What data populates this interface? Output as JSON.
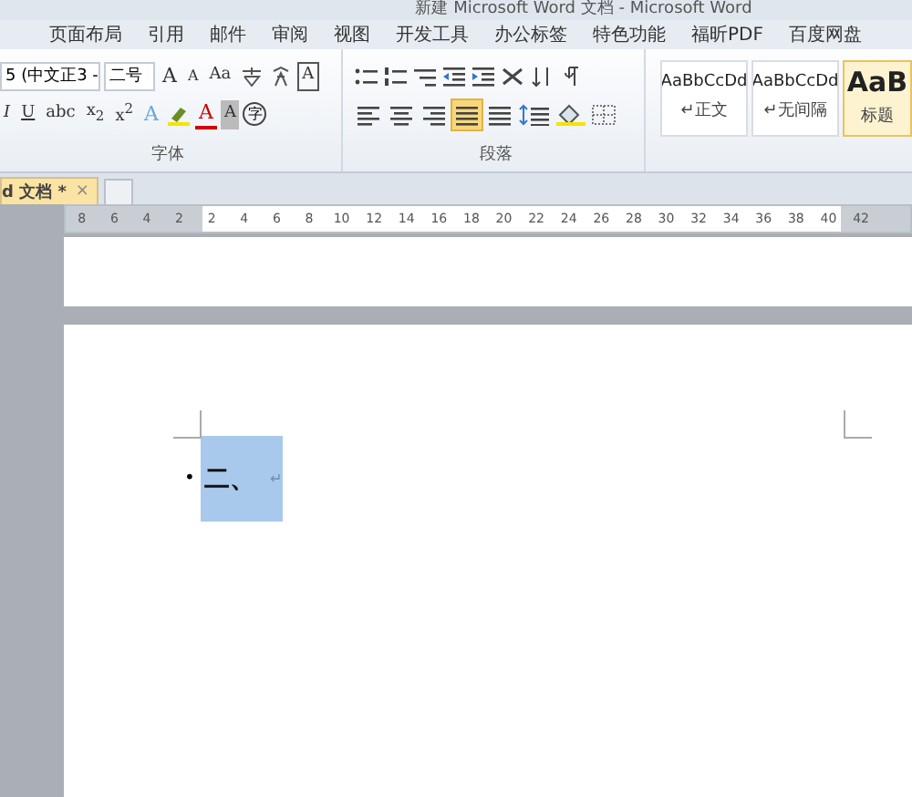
{
  "window": {
    "title": "新建 Microsoft Word 文档 - Microsoft Word"
  },
  "menu_tabs": [
    {
      "label": "页面布局",
      "selected": false
    },
    {
      "label": "引用",
      "selected": false
    },
    {
      "label": "邮件",
      "selected": false
    },
    {
      "label": "审阅",
      "selected": false
    },
    {
      "label": "视图",
      "selected": false
    },
    {
      "label": "开发工具",
      "selected": false
    },
    {
      "label": "办公标签",
      "selected": false
    },
    {
      "label": "特色功能",
      "selected": false
    },
    {
      "label": "福昕PDF",
      "selected": false
    },
    {
      "label": "百度网盘",
      "selected": false
    }
  ],
  "font_group": {
    "font_name": "5 (中文正3 -",
    "font_size": "二号",
    "grow": "A",
    "shrink": "A",
    "case": "Aa",
    "border": "A",
    "format_buttons": [
      "I",
      "U",
      "abc",
      "x$_{2}$",
      "x$^{2}$"
    ],
    "text_effect": "A",
    "font_color": "A",
    "shading": "A",
    "enclosed": "字",
    "label": "字体"
  },
  "paragraph_group": {
    "alignments": [
      {
        "selected": false
      },
      {
        "selected": false
      },
      {
        "selected": false
      },
      {
        "selected": true
      },
      {
        "selected": false
      }
    ],
    "label": "段落"
  },
  "styles": [
    {
      "preview": "AaBbCcDd",
      "name": "↵正文",
      "selected": false
    },
    {
      "preview": "AaBbCcDd",
      "name": "↵无间隔",
      "selected": false
    },
    {
      "preview": "AaB",
      "name": "标题 ",
      "selected": true
    }
  ],
  "document_tabs": [
    {
      "label": "d 文档 *",
      "close": "×",
      "selected": true
    }
  ],
  "ruler": [
    "8",
    "6",
    "4",
    "2",
    "2",
    "4",
    "6",
    "8",
    "10",
    "12",
    "14",
    "16",
    "18",
    "20",
    "22",
    "24",
    "26",
    "28",
    "30",
    "32",
    "34",
    "36",
    "38",
    "40",
    "42"
  ],
  "document": {
    "bullet": "•",
    "text": "二、",
    "mark": "↵",
    "selected": true
  }
}
